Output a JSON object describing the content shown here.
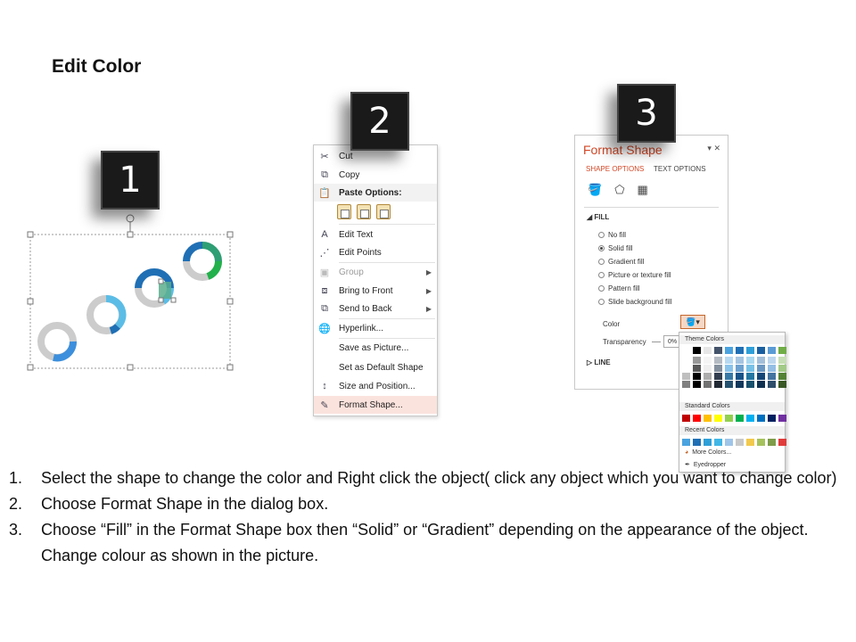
{
  "title": "Edit Color",
  "badges": [
    "1",
    "2",
    "3"
  ],
  "context_menu": {
    "items": [
      {
        "label": "Cut",
        "icon": "scissors-icon",
        "disabled": false
      },
      {
        "label": "Copy",
        "icon": "copy-icon",
        "disabled": false
      },
      {
        "label": "Paste Options:",
        "icon": "paste-icon",
        "disabled": false
      },
      {
        "label": "Edit Text",
        "icon": "edit-text-icon",
        "disabled": false
      },
      {
        "label": "Edit Points",
        "icon": "edit-points-icon",
        "disabled": false
      },
      {
        "label": "Group",
        "icon": "group-icon",
        "disabled": true
      },
      {
        "label": "Bring to Front",
        "icon": "bring-front-icon",
        "disabled": false
      },
      {
        "label": "Send to Back",
        "icon": "send-back-icon",
        "disabled": false
      },
      {
        "label": "Hyperlink...",
        "icon": "hyperlink-icon",
        "disabled": false
      },
      {
        "label": "Save as Picture...",
        "icon": "",
        "disabled": false
      },
      {
        "label": "Set as Default Shape",
        "icon": "",
        "disabled": false
      },
      {
        "label": "Size and Position...",
        "icon": "size-icon",
        "disabled": false
      },
      {
        "label": "Format Shape...",
        "icon": "format-shape-icon",
        "disabled": false
      }
    ]
  },
  "format_pane": {
    "title": "Format Shape",
    "tabs": [
      "SHAPE OPTIONS",
      "TEXT OPTIONS"
    ],
    "fill_header": "FILL",
    "fill_options": [
      "No fill",
      "Solid fill",
      "Gradient fill",
      "Picture or texture fill",
      "Pattern fill",
      "Slide background fill"
    ],
    "selected_fill": "Solid fill",
    "color_label": "Color",
    "transparency_label": "Transparency",
    "transparency_value": "0%",
    "line_header": "LINE"
  },
  "color_picker": {
    "theme_header": "Theme Colors",
    "standard_header": "Standard Colors",
    "recent_header": "Recent Colors",
    "more_colors": "More Colors...",
    "eyedropper": "Eyedropper",
    "theme_top": [
      "#ffffff",
      "#000000",
      "#e7e6e6",
      "#44546a",
      "#4aa3df",
      "#1f6fb5",
      "#2e9fd8",
      "#1a5fa0",
      "#5b9bd5",
      "#70ad47"
    ],
    "standard": [
      "#c00000",
      "#ff0000",
      "#ffc000",
      "#ffff00",
      "#92d050",
      "#00b050",
      "#00b0f0",
      "#0070c0",
      "#002060",
      "#7030a0"
    ],
    "recent": [
      "#4aa3df",
      "#1f6fb5",
      "#2e9fd8",
      "#41b6e6",
      "#9fc5e8",
      "#c9c9c9",
      "#f2c94c",
      "#a5c25c",
      "#7f9c4a",
      "#e03c3c",
      "#41b6e6"
    ]
  },
  "instructions": [
    {
      "num": "1.",
      "text": "Select the shape to change the color and Right click the object( click any object which you want to change color)"
    },
    {
      "num": "2.",
      "text": "Choose Format Shape in the dialog box."
    },
    {
      "num": "3.",
      "text": "Choose “Fill” in the Format Shape box then “Solid” or “Gradient” depending on the appearance of the object. Change colour as shown in the picture."
    }
  ]
}
